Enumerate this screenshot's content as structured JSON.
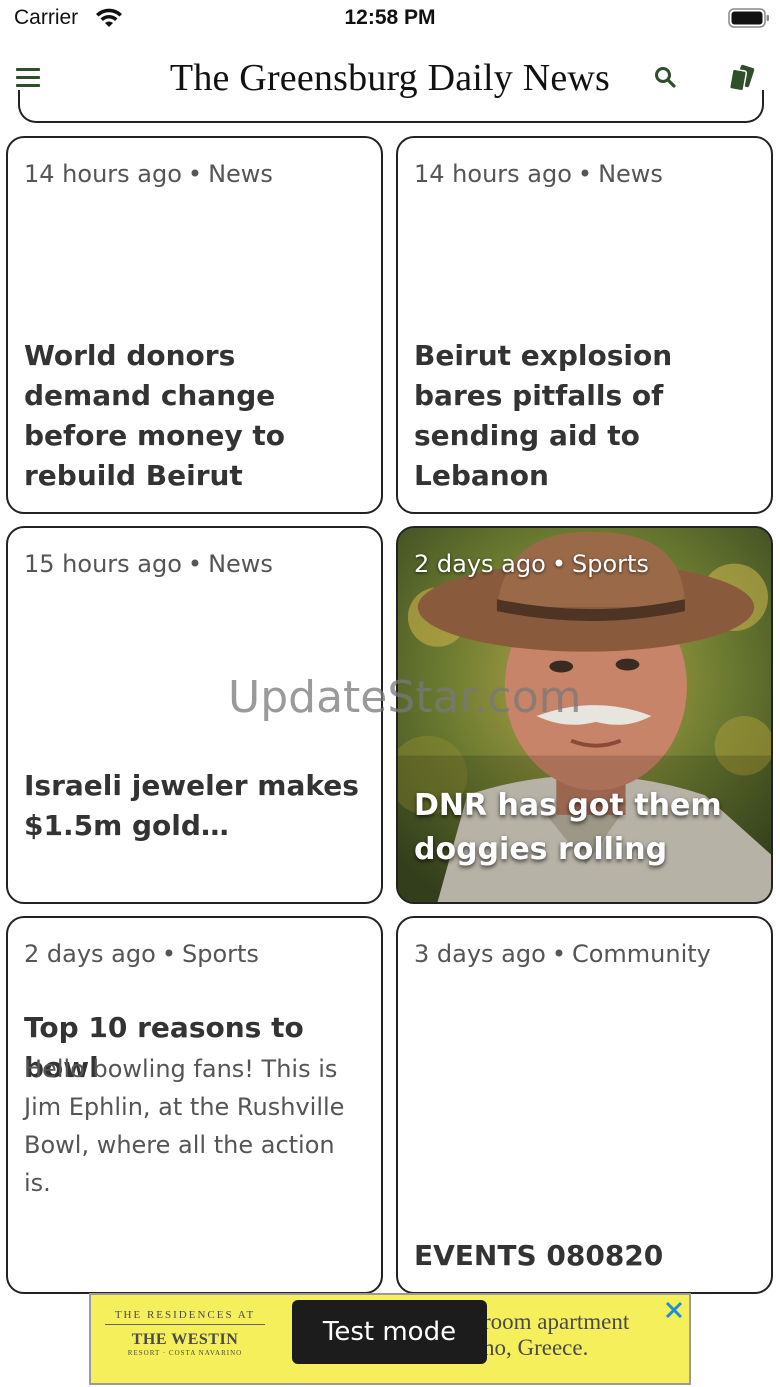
{
  "status_bar": {
    "carrier": "Carrier",
    "time": "12:58 PM"
  },
  "header": {
    "title": "The Greensburg Daily News",
    "menu_icon": "hamburger-menu-icon",
    "search_icon": "search-icon",
    "cards_icon": "cards-icon",
    "accent_color": "#2e4f2a"
  },
  "cards": [
    {
      "time": "14 hours ago",
      "category": "News",
      "headline": "World donors demand change before money to rebuild Beirut"
    },
    {
      "time": "14 hours ago",
      "category": "News",
      "headline": "Beirut explosion bares pitfalls of sending aid to Lebanon"
    },
    {
      "time": "15 hours ago",
      "category": "News",
      "headline": "Israeli jeweler makes $1.5m gold…"
    },
    {
      "time": "2 days ago",
      "category": "Sports",
      "headline": "DNR has got them doggies rolling"
    },
    {
      "time": "2 days ago",
      "category": "Sports",
      "headline": "Top 10 reasons to bowl",
      "summary": "Hello bowling fans! This is Jim Ephlin, at the Rushville Bowl, where all the action is."
    },
    {
      "time": "3 days ago",
      "category": "Community",
      "headline": "EVENTS 080820"
    }
  ],
  "separator": "•",
  "watermark": "UpdateStar.com",
  "ad": {
    "brand_line1": "THE RESIDENCES AT",
    "brand_line2": "THE WESTIN",
    "brand_line3": "RESORT · COSTA NAVARINO",
    "copy_line1": "room apartment",
    "copy_line2": "no, Greece.",
    "background": "#f6ef5c"
  },
  "toast": "Test mode"
}
